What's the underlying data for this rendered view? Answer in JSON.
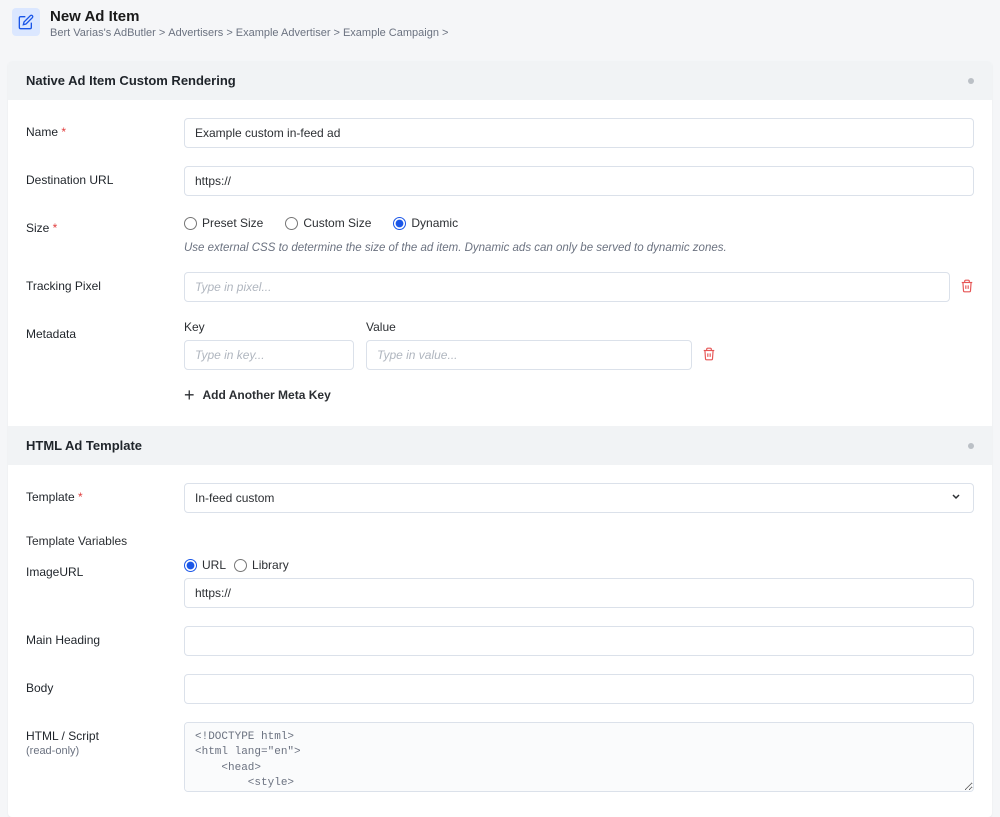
{
  "header": {
    "title": "New Ad Item",
    "breadcrumb": [
      "Bert Varias's AdButler",
      "Advertisers",
      "Example Advertiser",
      "Example Campaign",
      ""
    ]
  },
  "section1": {
    "title": "Native Ad Item Custom Rendering",
    "name_label": "Name",
    "name_value": "Example custom in-feed ad",
    "dest_label": "Destination URL",
    "dest_placeholder": "https://",
    "size_label": "Size",
    "size_options": {
      "preset": "Preset Size",
      "custom": "Custom Size",
      "dynamic": "Dynamic"
    },
    "size_help": "Use external CSS to determine the size of the ad item. Dynamic ads can only be served to dynamic zones.",
    "tracking_label": "Tracking Pixel",
    "tracking_placeholder": "Type in pixel...",
    "metadata_label": "Metadata",
    "meta_key_label": "Key",
    "meta_value_label": "Value",
    "meta_key_placeholder": "Type in key...",
    "meta_value_placeholder": "Type in value...",
    "add_meta_label": "Add Another Meta Key"
  },
  "section2": {
    "title": "HTML Ad Template",
    "template_label": "Template",
    "template_value": "In-feed custom",
    "tpl_vars_label": "Template Variables",
    "imageurl_label": "ImageURL",
    "imageurl_url": "URL",
    "imageurl_lib": "Library",
    "imageurl_placeholder": "https://",
    "main_heading_label": "Main Heading",
    "body_label": "Body",
    "html_label": "HTML / Script",
    "html_sublabel": "(read-only)",
    "html_code": "<!DOCTYPE html>\n<html lang=\"en\">\n    <head>\n        <style>\n            .in-feed-container {\n                position: relative;\n                float: left;"
  }
}
